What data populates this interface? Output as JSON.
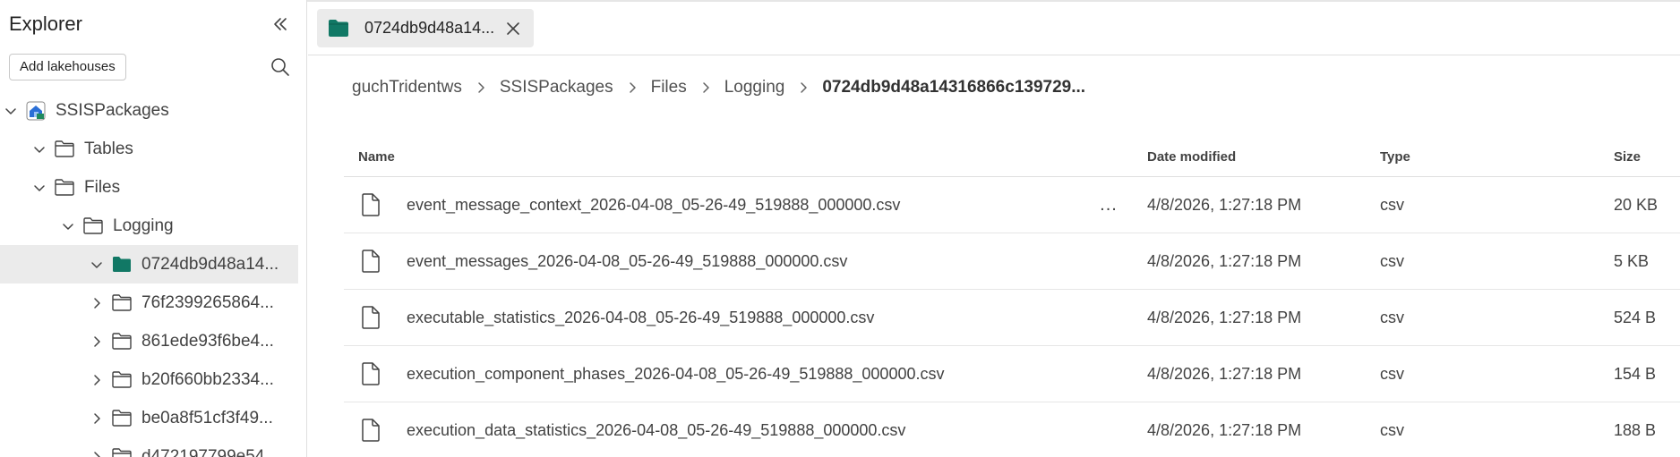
{
  "explorer": {
    "title": "Explorer",
    "add_button": "Add lakehouses",
    "tree": [
      {
        "label": "SSISPackages",
        "depth": 0,
        "expanded": true,
        "icon": "lakehouse-icon",
        "selected": false
      },
      {
        "label": "Tables",
        "depth": 1,
        "expanded": true,
        "icon": "folder-icon",
        "selected": false
      },
      {
        "label": "Files",
        "depth": 1,
        "expanded": true,
        "icon": "folder-icon",
        "selected": false
      },
      {
        "label": "Logging",
        "depth": 2,
        "expanded": true,
        "icon": "folder-icon",
        "selected": false
      },
      {
        "label": "0724db9d48a14...",
        "depth": 3,
        "expanded": true,
        "icon": "folder-filled-icon",
        "selected": true
      },
      {
        "label": "76f2399265864...",
        "depth": 3,
        "expanded": false,
        "icon": "folder-icon",
        "selected": false
      },
      {
        "label": "861ede93f6be4...",
        "depth": 3,
        "expanded": false,
        "icon": "folder-icon",
        "selected": false
      },
      {
        "label": "b20f660bb2334...",
        "depth": 3,
        "expanded": false,
        "icon": "folder-icon",
        "selected": false
      },
      {
        "label": "be0a8f51cf3f49...",
        "depth": 3,
        "expanded": false,
        "icon": "folder-icon",
        "selected": false
      },
      {
        "label": "d472197799e54...",
        "depth": 3,
        "expanded": false,
        "icon": "folder-icon",
        "selected": false
      }
    ]
  },
  "tab": {
    "label": "0724db9d48a14...",
    "icon": "folder-filled-icon",
    "accent": "#117865"
  },
  "breadcrumb": [
    "guchTridentws",
    "SSISPackages",
    "Files",
    "Logging",
    "0724db9d48a14316866c139729..."
  ],
  "table": {
    "headers": {
      "name": "Name",
      "date": "Date modified",
      "type": "Type",
      "size": "Size"
    },
    "rows": [
      {
        "name": "event_message_context_2026-04-08_05-26-49_519888_000000.csv",
        "date": "4/8/2026, 1:27:18 PM",
        "type": "csv",
        "size": "20 KB"
      },
      {
        "name": "event_messages_2026-04-08_05-26-49_519888_000000.csv",
        "date": "4/8/2026, 1:27:18 PM",
        "type": "csv",
        "size": "5 KB"
      },
      {
        "name": "executable_statistics_2026-04-08_05-26-49_519888_000000.csv",
        "date": "4/8/2026, 1:27:18 PM",
        "type": "csv",
        "size": "524 B"
      },
      {
        "name": "execution_component_phases_2026-04-08_05-26-49_519888_000000.csv",
        "date": "4/8/2026, 1:27:18 PM",
        "type": "csv",
        "size": "154 B"
      },
      {
        "name": "execution_data_statistics_2026-04-08_05-26-49_519888_000000.csv",
        "date": "4/8/2026, 1:27:18 PM",
        "type": "csv",
        "size": "188 B"
      }
    ],
    "row_more_label": "..."
  }
}
